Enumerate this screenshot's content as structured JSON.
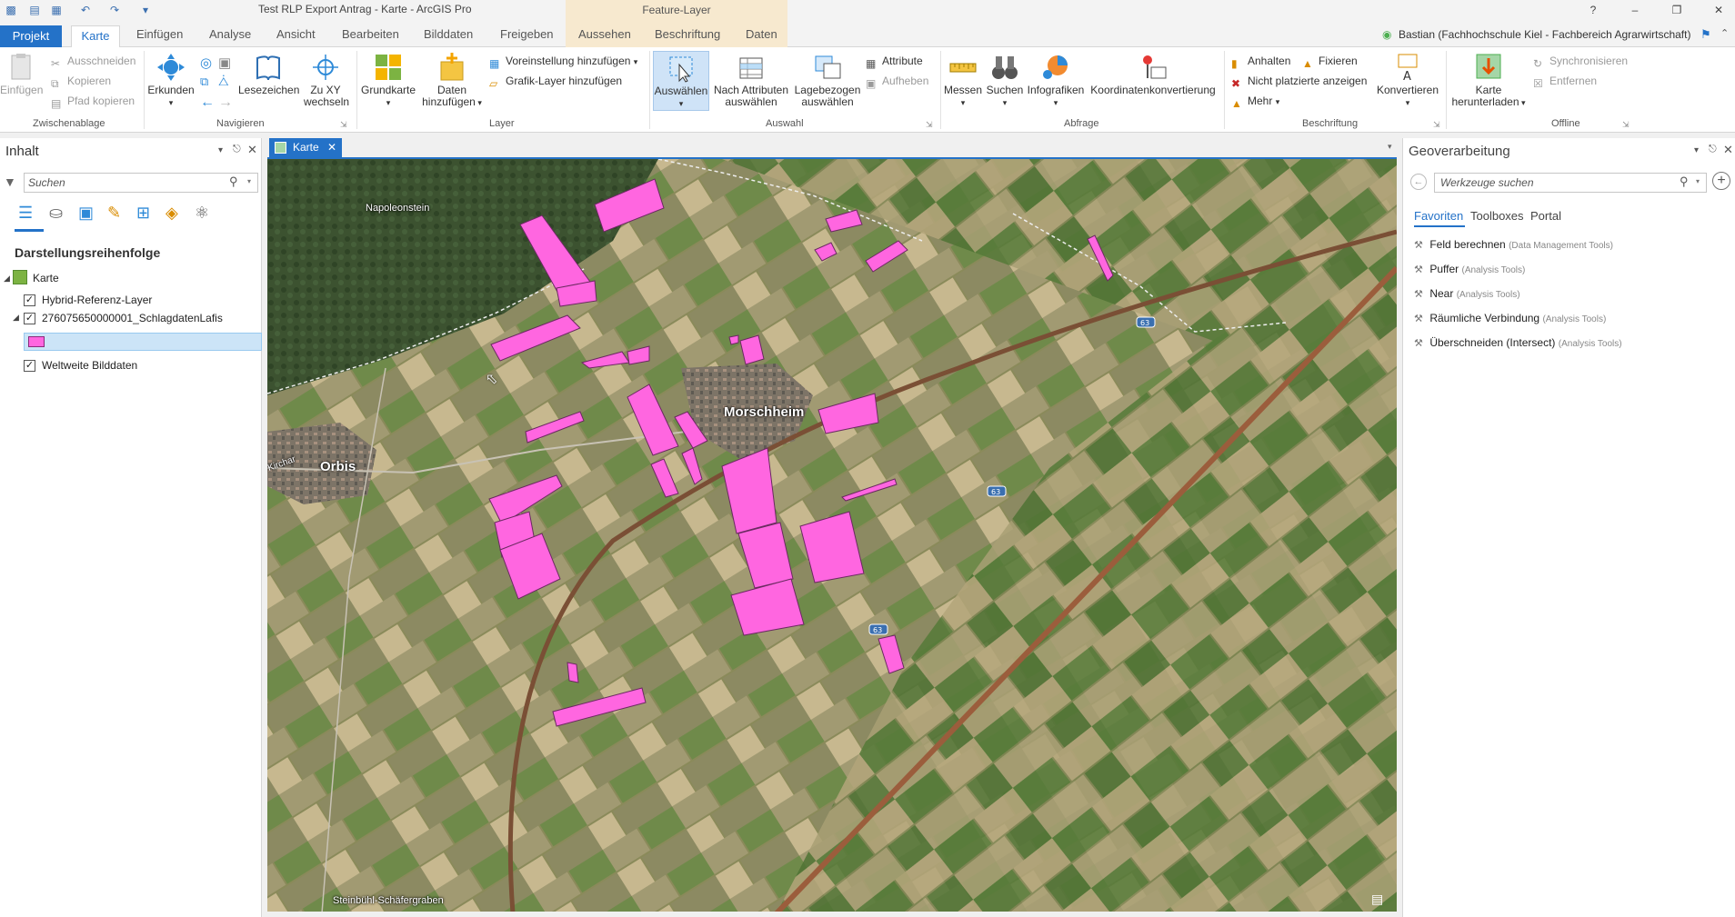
{
  "window": {
    "title": "Test RLP Export Antrag - Karte - ArcGIS Pro",
    "contextual_header": "Feature-Layer",
    "help": "?",
    "minimize": "–",
    "restore": "❐",
    "close": "✕"
  },
  "tabs": {
    "projekt": "Projekt",
    "items": [
      "Karte",
      "Einfügen",
      "Analyse",
      "Ansicht",
      "Bearbeiten",
      "Bilddaten",
      "Freigeben",
      "Aussehen",
      "Beschriftung",
      "Daten"
    ],
    "user": "Bastian (Fachhochschule Kiel - Fachbereich Agrarwirtschaft)"
  },
  "ribbon": {
    "clipboard": {
      "paste": "Einfügen",
      "cut": "Ausschneiden",
      "copy": "Kopieren",
      "copy_path": "Pfad kopieren",
      "label": "Zwischenablage"
    },
    "navigate": {
      "explore": "Erkunden",
      "bookmarks": "Lesezeichen",
      "goto_xy_1": "Zu XY",
      "goto_xy_2": "wechseln",
      "label": "Navigieren"
    },
    "layer": {
      "basemap": "Grundkarte",
      "add_data_1": "Daten",
      "add_data_2": "hinzufügen",
      "add_preset": "Voreinstellung hinzufügen",
      "add_graphics": "Grafik-Layer hinzufügen",
      "label": "Layer"
    },
    "selection": {
      "select": "Auswählen",
      "by_attr_1": "Nach Attributen",
      "by_attr_2": "auswählen",
      "by_loc_1": "Lagebezogen",
      "by_loc_2": "auswählen",
      "attributes": "Attribute",
      "clear": "Aufheben",
      "label": "Auswahl"
    },
    "inquiry": {
      "measure": "Messen",
      "locate": "Suchen",
      "infographics": "Infografiken",
      "coord_conv": "Koordinatenkonvertierung",
      "label": "Abfrage"
    },
    "labeling": {
      "pause": "Anhalten",
      "lock": "Fixieren",
      "unplaced": "Nicht platzierte anzeigen",
      "more": "Mehr",
      "convert": "Konvertieren",
      "label": "Beschriftung"
    },
    "offline": {
      "download_1": "Karte",
      "download_2": "herunterladen",
      "sync": "Synchronisieren",
      "remove": "Entfernen",
      "label": "Offline"
    }
  },
  "contents": {
    "title": "Inhalt",
    "search_placeholder": "Suchen",
    "draw_order": "Darstellungsreihenfolge",
    "map_name": "Karte",
    "layers": [
      "Hybrid-Referenz-Layer",
      "276075650000001_SchlagdatenLafis",
      "Weltweite Bilddaten"
    ]
  },
  "map": {
    "tab_label": "Karte",
    "places": {
      "napoleonstein": "Napoleonstein",
      "morschheim": "Morschheim",
      "orbis": "Orbis",
      "steinbuehl": "Steinbühl-Schäfergraben",
      "road_label": "Kirchar"
    },
    "highway_shield": "63"
  },
  "geoprocessing": {
    "title": "Geoverarbeitung",
    "search_placeholder": "Werkzeuge suchen",
    "tabs": [
      "Favoriten",
      "Toolboxes",
      "Portal"
    ],
    "tools": [
      {
        "name": "Feld berechnen",
        "toolbox": "(Data Management Tools)"
      },
      {
        "name": "Puffer",
        "toolbox": "(Analysis Tools)"
      },
      {
        "name": "Near",
        "toolbox": "(Analysis Tools)"
      },
      {
        "name": "Räumliche Verbindung",
        "toolbox": "(Analysis Tools)"
      },
      {
        "name": "Überschneiden (Intersect)",
        "toolbox": "(Analysis Tools)"
      }
    ]
  },
  "colors": {
    "accent": "#2472c8",
    "parcel_fill": "#ff66e0",
    "contextual_tab": "#f7e9cf"
  }
}
